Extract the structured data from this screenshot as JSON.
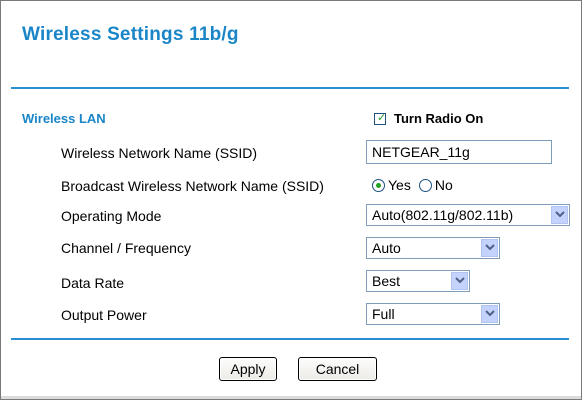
{
  "page": {
    "title": "Wireless Settings 11b/g"
  },
  "wireless_lan": {
    "section_label": "Wireless LAN",
    "turn_radio_on": {
      "label": "Turn Radio On",
      "checked": true
    },
    "ssid": {
      "label": "Wireless Network Name (SSID)",
      "value": "NETGEAR_11g"
    },
    "broadcast": {
      "label": "Broadcast Wireless Network Name (SSID)",
      "options": [
        {
          "label": "Yes",
          "selected": true
        },
        {
          "label": "No",
          "selected": false
        }
      ]
    },
    "operating_mode": {
      "label": "Operating Mode",
      "value": "Auto(802.11g/802.11b)"
    },
    "channel": {
      "label": "Channel / Frequency",
      "value": "Auto"
    },
    "data_rate": {
      "label": "Data Rate",
      "value": "Best"
    },
    "output_power": {
      "label": "Output Power",
      "value": "Full"
    }
  },
  "buttons": {
    "apply": "Apply",
    "cancel": "Cancel"
  },
  "colors": {
    "accent": "#1a86c8",
    "rule": "#2a8fd0",
    "check": "#21a121"
  }
}
